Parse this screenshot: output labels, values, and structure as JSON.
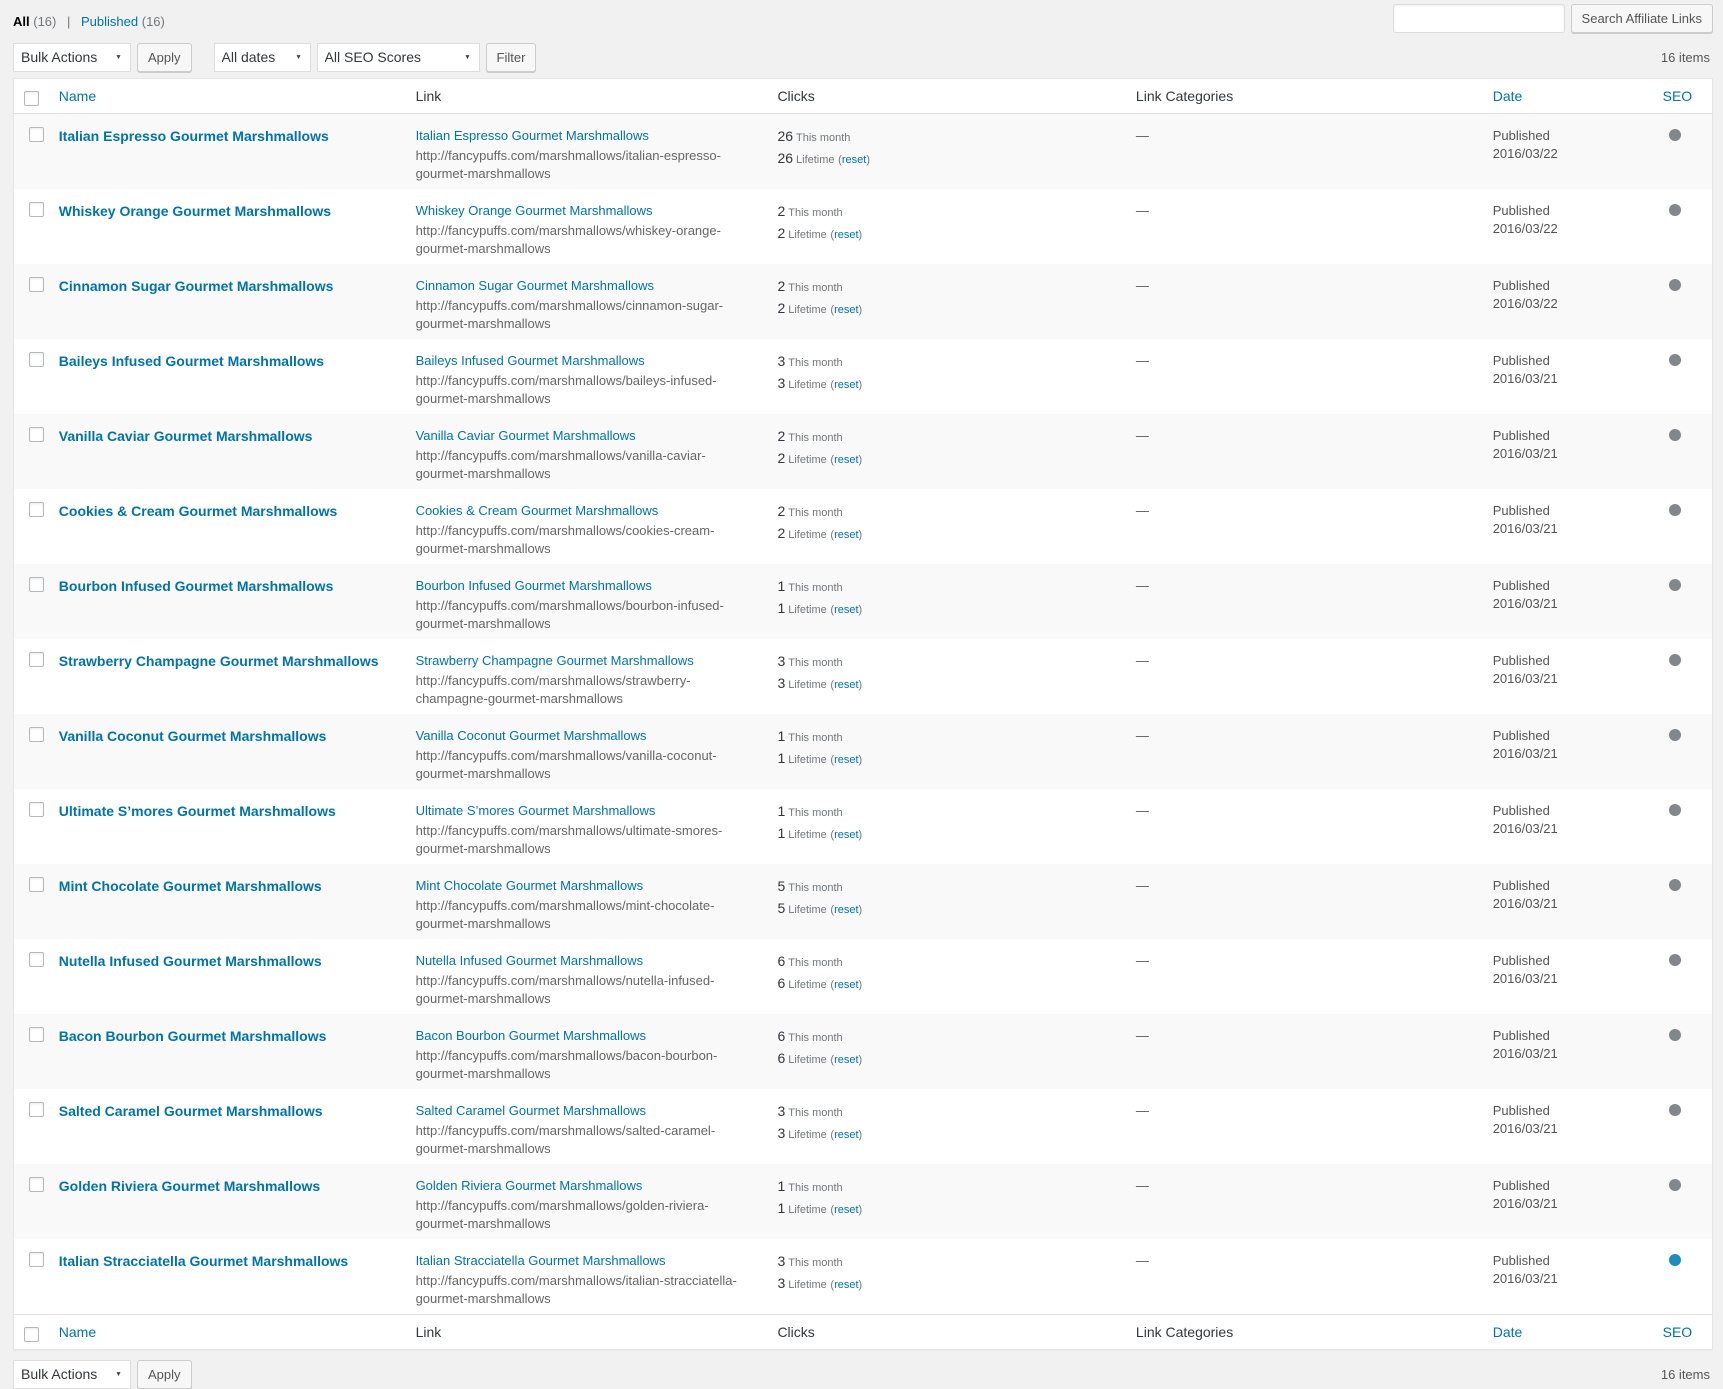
{
  "colors": {
    "page_bg": "#f1f1f1",
    "link_blue": "#0073aa",
    "seo_gray": "#82878c",
    "seo_blue": "#1e8cbe"
  },
  "views": {
    "all_label": "All",
    "all_count": "(16)",
    "separator": "|",
    "published_label": "Published",
    "published_count": "(16)"
  },
  "search": {
    "value": "",
    "button_label": "Search Affiliate Links"
  },
  "toolbar": {
    "bulk_actions": "Bulk Actions",
    "apply": "Apply",
    "all_dates": "All dates",
    "all_seo_scores": "All SEO Scores",
    "filter": "Filter",
    "items_count": "16 items"
  },
  "table": {
    "headers": {
      "name": "Name",
      "link": "Link",
      "clicks": "Clicks",
      "categories": "Link Categories",
      "date": "Date",
      "seo": "SEO"
    }
  },
  "labels": {
    "this_month": "This month",
    "lifetime": "Lifetime",
    "paren_open": "(",
    "reset_link": "reset",
    "paren_close": ")"
  },
  "rows": [
    {
      "name": "Italian Espresso Gourmet Marshmallows",
      "link_title": "Italian Espresso Gourmet Marshmallows",
      "link_url": "http://fancypuffs.com/marshmallows/italian-espresso-gourmet-marshmallows",
      "clicks_month": "26",
      "clicks_lifetime": "26",
      "categories": "—",
      "status": "Published",
      "date": "2016/03/22",
      "seo": "gray",
      "seo_color": "#82878c"
    },
    {
      "name": "Whiskey Orange Gourmet Marshmallows",
      "link_title": "Whiskey Orange Gourmet Marshmallows",
      "link_url": "http://fancypuffs.com/marshmallows/whiskey-orange-gourmet-marshmallows",
      "clicks_month": "2",
      "clicks_lifetime": "2",
      "categories": "—",
      "status": "Published",
      "date": "2016/03/22",
      "seo": "gray",
      "seo_color": "#82878c"
    },
    {
      "name": "Cinnamon Sugar Gourmet Marshmallows",
      "link_title": "Cinnamon Sugar Gourmet Marshmallows",
      "link_url": "http://fancypuffs.com/marshmallows/cinnamon-sugar-gourmet-marshmallows",
      "clicks_month": "2",
      "clicks_lifetime": "2",
      "categories": "—",
      "status": "Published",
      "date": "2016/03/22",
      "seo": "gray",
      "seo_color": "#82878c"
    },
    {
      "name": "Baileys Infused Gourmet Marshmallows",
      "link_title": "Baileys Infused Gourmet Marshmallows",
      "link_url": "http://fancypuffs.com/marshmallows/baileys-infused-gourmet-marshmallows",
      "clicks_month": "3",
      "clicks_lifetime": "3",
      "categories": "—",
      "status": "Published",
      "date": "2016/03/21",
      "seo": "gray",
      "seo_color": "#82878c"
    },
    {
      "name": "Vanilla Caviar Gourmet Marshmallows",
      "link_title": "Vanilla Caviar Gourmet Marshmallows",
      "link_url": "http://fancypuffs.com/marshmallows/vanilla-caviar-gourmet-marshmallows",
      "clicks_month": "2",
      "clicks_lifetime": "2",
      "categories": "—",
      "status": "Published",
      "date": "2016/03/21",
      "seo": "gray",
      "seo_color": "#82878c"
    },
    {
      "name": "Cookies & Cream Gourmet Marshmallows",
      "link_title": "Cookies & Cream Gourmet Marshmallows",
      "link_url": "http://fancypuffs.com/marshmallows/cookies-cream-gourmet-marshmallows",
      "clicks_month": "2",
      "clicks_lifetime": "2",
      "categories": "—",
      "status": "Published",
      "date": "2016/03/21",
      "seo": "gray",
      "seo_color": "#82878c"
    },
    {
      "name": "Bourbon Infused Gourmet Marshmallows",
      "link_title": "Bourbon Infused Gourmet Marshmallows",
      "link_url": "http://fancypuffs.com/marshmallows/bourbon-infused-gourmet-marshmallows",
      "clicks_month": "1",
      "clicks_lifetime": "1",
      "categories": "—",
      "status": "Published",
      "date": "2016/03/21",
      "seo": "gray",
      "seo_color": "#82878c"
    },
    {
      "name": "Strawberry Champagne Gourmet Marshmallows",
      "link_title": "Strawberry Champagne Gourmet Marshmallows",
      "link_url": "http://fancypuffs.com/marshmallows/strawberry-champagne-gourmet-marshmallows",
      "clicks_month": "3",
      "clicks_lifetime": "3",
      "categories": "—",
      "status": "Published",
      "date": "2016/03/21",
      "seo": "gray",
      "seo_color": "#82878c"
    },
    {
      "name": "Vanilla Coconut Gourmet Marshmallows",
      "link_title": "Vanilla Coconut Gourmet Marshmallows",
      "link_url": "http://fancypuffs.com/marshmallows/vanilla-coconut-gourmet-marshmallows",
      "clicks_month": "1",
      "clicks_lifetime": "1",
      "categories": "—",
      "status": "Published",
      "date": "2016/03/21",
      "seo": "gray",
      "seo_color": "#82878c"
    },
    {
      "name": "Ultimate S’mores Gourmet Marshmallows",
      "link_title": "Ultimate S’mores Gourmet Marshmallows",
      "link_url": "http://fancypuffs.com/marshmallows/ultimate-smores-gourmet-marshmallows",
      "clicks_month": "1",
      "clicks_lifetime": "1",
      "categories": "—",
      "status": "Published",
      "date": "2016/03/21",
      "seo": "gray",
      "seo_color": "#82878c"
    },
    {
      "name": "Mint Chocolate Gourmet Marshmallows",
      "link_title": "Mint Chocolate Gourmet Marshmallows",
      "link_url": "http://fancypuffs.com/marshmallows/mint-chocolate-gourmet-marshmallows",
      "clicks_month": "5",
      "clicks_lifetime": "5",
      "categories": "—",
      "status": "Published",
      "date": "2016/03/21",
      "seo": "gray",
      "seo_color": "#82878c"
    },
    {
      "name": "Nutella Infused Gourmet Marshmallows",
      "link_title": "Nutella Infused Gourmet Marshmallows",
      "link_url": "http://fancypuffs.com/marshmallows/nutella-infused-gourmet-marshmallows",
      "clicks_month": "6",
      "clicks_lifetime": "6",
      "categories": "—",
      "status": "Published",
      "date": "2016/03/21",
      "seo": "gray",
      "seo_color": "#82878c"
    },
    {
      "name": "Bacon Bourbon Gourmet Marshmallows",
      "link_title": "Bacon Bourbon Gourmet Marshmallows",
      "link_url": "http://fancypuffs.com/marshmallows/bacon-bourbon-gourmet-marshmallows",
      "clicks_month": "6",
      "clicks_lifetime": "6",
      "categories": "—",
      "status": "Published",
      "date": "2016/03/21",
      "seo": "gray",
      "seo_color": "#82878c"
    },
    {
      "name": "Salted Caramel Gourmet Marshmallows",
      "link_title": "Salted Caramel Gourmet Marshmallows",
      "link_url": "http://fancypuffs.com/marshmallows/salted-caramel-gourmet-marshmallows",
      "clicks_month": "3",
      "clicks_lifetime": "3",
      "categories": "—",
      "status": "Published",
      "date": "2016/03/21",
      "seo": "gray",
      "seo_color": "#82878c"
    },
    {
      "name": "Golden Riviera Gourmet Marshmallows",
      "link_title": "Golden Riviera Gourmet Marshmallows",
      "link_url": "http://fancypuffs.com/marshmallows/golden-riviera-gourmet-marshmallows",
      "clicks_month": "1",
      "clicks_lifetime": "1",
      "categories": "—",
      "status": "Published",
      "date": "2016/03/21",
      "seo": "gray",
      "seo_color": "#82878c"
    },
    {
      "name": "Italian Stracciatella Gourmet Marshmallows",
      "link_title": "Italian Stracciatella Gourmet Marshmallows",
      "link_url": "http://fancypuffs.com/marshmallows/italian-stracciatella-gourmet-marshmallows",
      "clicks_month": "3",
      "clicks_lifetime": "3",
      "categories": "—",
      "status": "Published",
      "date": "2016/03/21",
      "seo": "blue",
      "seo_color": "#1e8cbe"
    }
  ]
}
